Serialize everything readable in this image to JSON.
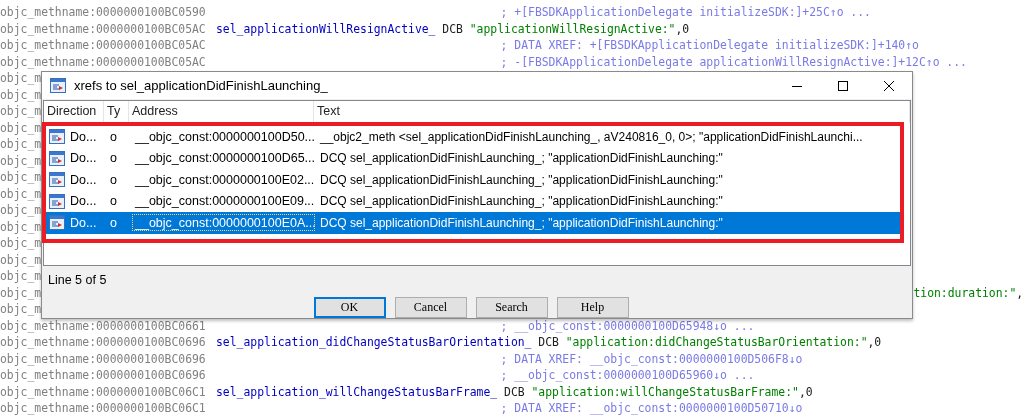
{
  "listing": {
    "lines": [
      {
        "kind": "comment",
        "address": "objc_methname:0000000100BC0590",
        "comment": "; +[FBSDKApplicationDelegate initializeSDK:]+25C↑o ..."
      },
      {
        "kind": "label",
        "address": "objc_methname:0000000100BC05AC",
        "label": "sel_applicationWillResignActive_",
        "directive": "DCB",
        "string": "\"applicationWillResignActive:\"",
        "suffix": ",0"
      },
      {
        "kind": "comment",
        "address": "objc_methname:0000000100BC05AC",
        "comment": "; DATA XREF: +[FBSDKApplicationDelegate initializeSDK:]+140↑o"
      },
      {
        "kind": "comment",
        "address": "objc_methname:0000000100BC05AC",
        "comment": "; -[FBSDKApplicationDelegate applicationWillResignActive:]+12C↑o ..."
      },
      {
        "kind": "address",
        "address": "objc_m"
      },
      {
        "kind": "address",
        "address": "objc_m"
      },
      {
        "kind": "address",
        "address": "objc_m"
      },
      {
        "kind": "address",
        "address": "objc_m"
      },
      {
        "kind": "address",
        "address": "objc_m"
      },
      {
        "kind": "address",
        "address": "objc_m"
      },
      {
        "kind": "address",
        "address": "objc_m"
      },
      {
        "kind": "address",
        "address": "objc_m"
      },
      {
        "kind": "address",
        "address": "objc_m"
      },
      {
        "kind": "address",
        "address": "objc_m"
      },
      {
        "kind": "address",
        "address": "objc_m"
      },
      {
        "kind": "address",
        "address": "objc_m"
      },
      {
        "kind": "address",
        "address": "objc_m"
      },
      {
        "kind": "tail",
        "address": "objc_m",
        "string": "tion:duration:\"",
        "suffix": ","
      },
      {
        "kind": "address",
        "address": "objc_m"
      },
      {
        "kind": "comment",
        "address": "objc_methname:0000000100BC0661",
        "comment": "; __objc_const:0000000100D65948↓o ..."
      },
      {
        "kind": "label",
        "address": "objc_methname:0000000100BC0696",
        "label": "sel_application_didChangeStatusBarOrientation_",
        "directive": "DCB",
        "string": "\"application:didChangeStatusBarOrientation:\"",
        "suffix": ",0"
      },
      {
        "kind": "comment",
        "address": "objc_methname:0000000100BC0696",
        "comment": "; DATA XREF: __objc_const:0000000100D506F8↓o"
      },
      {
        "kind": "comment",
        "address": "objc_methname:0000000100BC0696",
        "comment": "; __objc_const:0000000100D65960↓o ..."
      },
      {
        "kind": "label",
        "address": "objc_methname:0000000100BC06C1",
        "label": "sel_application_willChangeStatusBarFrame_",
        "directive": "DCB",
        "string": "\"application:willChangeStatusBarFrame:\"",
        "suffix": ",0"
      },
      {
        "kind": "comment",
        "address": "objc_methname:0000000100BC06C1",
        "comment": "; DATA XREF: __objc_const:0000000100D50710↓o"
      }
    ]
  },
  "dialog": {
    "title": "xrefs to sel_applicationDidFinishLaunching_",
    "columns": [
      "Direction",
      "Ty",
      "Address",
      "Text"
    ],
    "rows": [
      {
        "direction": "Do...",
        "type": "o",
        "address": "__objc_const:0000000100D50...",
        "text": "__objc2_meth <sel_applicationDidFinishLaunching_, aV240816_0, 0>; \"applicationDidFinishLaunchi...",
        "selected": false
      },
      {
        "direction": "Do...",
        "type": "o",
        "address": "__objc_const:0000000100D65...",
        "text": "DCQ sel_applicationDidFinishLaunching_; \"applicationDidFinishLaunching:\"",
        "selected": false
      },
      {
        "direction": "Do...",
        "type": "o",
        "address": "__objc_const:0000000100E02...",
        "text": "DCQ sel_applicationDidFinishLaunching_; \"applicationDidFinishLaunching:\"",
        "selected": false
      },
      {
        "direction": "Do...",
        "type": "o",
        "address": "__objc_const:0000000100E09...",
        "text": "DCQ sel_applicationDidFinishLaunching_; \"applicationDidFinishLaunching:\"",
        "selected": false
      },
      {
        "direction": "Do...",
        "type": "o",
        "address": "__objc_const:0000000100E0A...",
        "text": "DCQ sel_applicationDidFinishLaunching_; \"applicationDidFinishLaunching:\"",
        "selected": true
      }
    ],
    "status": "Line 5 of 5",
    "buttons": [
      {
        "label": "OK",
        "default": true
      },
      {
        "label": "Cancel",
        "default": false
      },
      {
        "label": "Search",
        "default": false
      },
      {
        "label": "Help",
        "default": false
      }
    ]
  }
}
